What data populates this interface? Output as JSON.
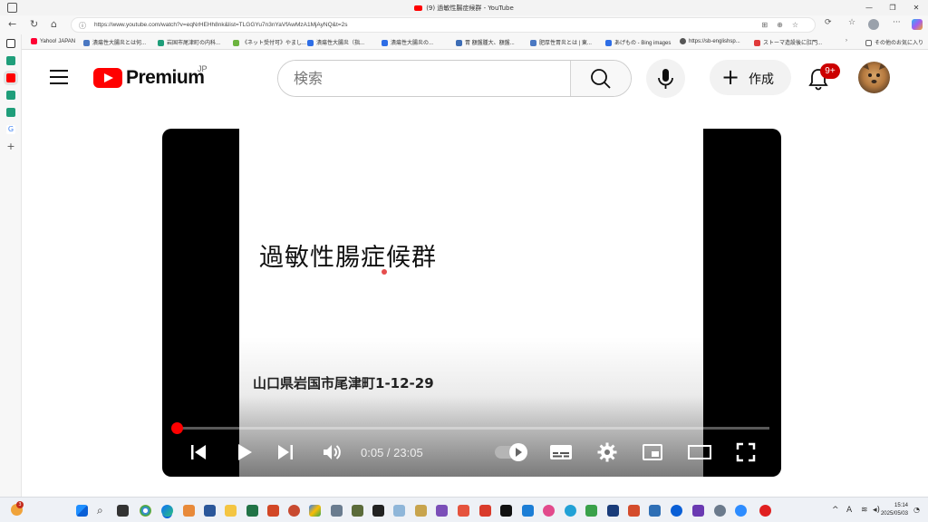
{
  "browser": {
    "tab_title": "(9) 過敏性腸症候群 - YouTube",
    "url": "https://www.youtube.com/watch?v=eqNrHEHh8nk&list=TLGGYu7n3nYaVfAwMzA1MjAyNQ&t=2s",
    "bookmarks": [
      {
        "label": "Yahoo! JAPAN",
        "color": "#ff0033"
      },
      {
        "label": "潰瘍性大腸炎とは何...",
        "color": "#4a78c2"
      },
      {
        "label": "岩国市尾津町の内科...",
        "color": "#1f9e7a"
      },
      {
        "label": "《ネット受付可》やまし...",
        "color": "#6cb33f"
      },
      {
        "label": "潰瘍性大腸炎（指...",
        "color": "#2e6ee6"
      },
      {
        "label": "潰瘍性大腸炎の...",
        "color": "#2e6ee6"
      },
      {
        "label": "胃 額盤腫大、額盤...",
        "color": "#3d6db5"
      },
      {
        "label": "肥厚性胃炎とは | 東...",
        "color": "#4a78c2"
      },
      {
        "label": "あげもの - Bing images",
        "color": "#2e6ee6"
      },
      {
        "label": "https://sb-englishsp...",
        "color": "#555555"
      },
      {
        "label": "ストーマ造設後に肛門...",
        "color": "#e03a3a"
      }
    ],
    "other_favorites": "その他のお気に入り"
  },
  "youtube": {
    "logo_text": "Premium",
    "region": "JP",
    "search_placeholder": "検索",
    "create_label": "作成",
    "notification_count": "9+"
  },
  "video": {
    "slide_title": "過敏性腸症候群",
    "slide_address": "山口県岩国市尾津町1-12-29",
    "current_time": "0:05",
    "duration": "23:05",
    "time_display": "0:05 / 23:05",
    "progress_fraction": 0.004
  },
  "taskbar": {
    "notification_badge": "3",
    "time": "15:14",
    "date": "2025/05/03",
    "ime": "A"
  },
  "colors": {
    "youtube_red": "#ff0000",
    "badge_red": "#cc0000"
  }
}
